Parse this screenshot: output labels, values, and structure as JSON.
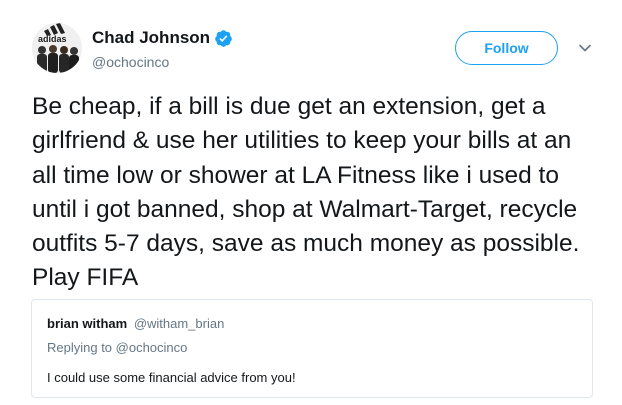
{
  "author": {
    "name": "Chad Johnson",
    "handle": "@ochocinco",
    "verified": true,
    "avatar_text": "adidas"
  },
  "follow_label": "Follow",
  "icons": {
    "verified": "verified-badge-icon",
    "more": "chevron-down-icon"
  },
  "colors": {
    "accent": "#1da1f2",
    "text": "#14171a",
    "secondary": "#657786",
    "border": "#e1e8ed"
  },
  "tweet": {
    "text": "Be cheap, if a bill is due get an extension, get a girlfriend & use her utilities to keep your bills at an all time low or shower at LA Fitness like i used to until i got banned, shop at Walmart-Target, recycle outfits 5-7 days, save as much money as possible. Play FIFA"
  },
  "quoted": {
    "name": "brian witham",
    "handle": "@witham_brian",
    "replying_to": "Replying to @ochocinco",
    "text": "I could use some financial advice from you!"
  }
}
